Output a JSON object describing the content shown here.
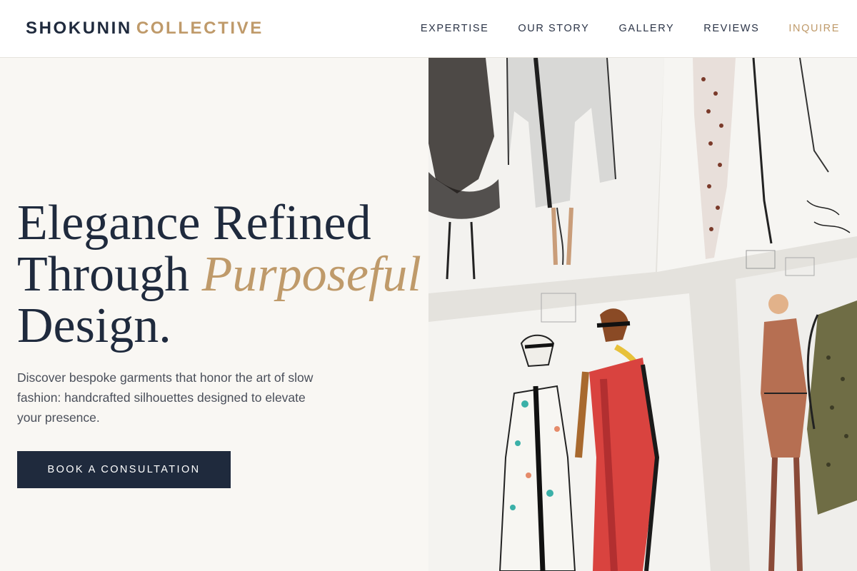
{
  "brand": {
    "part1": "SHOKUNIN",
    "part2": "COLLECTIVE"
  },
  "nav": {
    "expertise": "EXPERTISE",
    "our_story": "OUR STORY",
    "gallery": "GALLERY",
    "reviews": "REVIEWS",
    "inquire": "INQUIRE"
  },
  "hero": {
    "headline_line1": "Elegance Refined",
    "headline_line2a": "Through ",
    "headline_line2b": "Purposeful",
    "headline_line3": "Design.",
    "subtext": "Discover bespoke garments that honor the art of slow fashion: handcrafted silhouettes designed to elevate your presence.",
    "cta_label": "BOOK A CONSULTATION",
    "image_alt": "fashion-sketches-wall-image"
  },
  "colors": {
    "navy": "#1f2a3d",
    "gold": "#bf9a6a",
    "background": "#f9f7f3"
  }
}
